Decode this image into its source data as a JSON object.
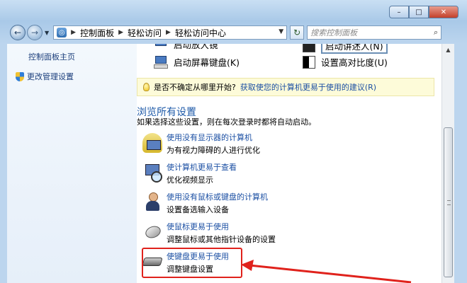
{
  "window": {
    "controls": {
      "minimize": "–",
      "maximize": "□",
      "close": "✕"
    }
  },
  "nav": {
    "back_icon": "←",
    "forward_icon": "→",
    "crumb_icon": "◎",
    "breadcrumbs": [
      "控制面板",
      "轻松访问",
      "轻松访问中心"
    ],
    "refresh_icon": "↻",
    "search_placeholder": "搜索控制面板"
  },
  "sidebar": {
    "home_link": "控制面板主页",
    "admin_link": "更改管理设置"
  },
  "top_items": {
    "left_cut": "启动放大镜",
    "right_cut": "启动讲述人(N)",
    "left": "启动屏幕键盘(K)",
    "right": "设置高对比度(U)"
  },
  "tip": {
    "question": "是否不确定从哪里开始?",
    "link": "获取使您的计算机更易于使用的建议(R)"
  },
  "section": {
    "title": "浏览所有设置",
    "description": "如果选择这些设置，则在每次登录时都将自动启动。"
  },
  "options": [
    {
      "link": "使用没有显示器的计算机",
      "desc": "为有视力障碍的人进行优化",
      "icon": "monitor-icon"
    },
    {
      "link": "使计算机更易于查看",
      "desc": "优化视频显示",
      "icon": "magnifier-icon"
    },
    {
      "link": "使用没有鼠标或键盘的计算机",
      "desc": "设置备选输入设备",
      "icon": "person-icon"
    },
    {
      "link": "使鼠标更易于使用",
      "desc": "调整鼠标或其他指针设备的设置",
      "icon": "mouse-icon"
    },
    {
      "link": "使键盘更易于使用",
      "desc": "调整键盘设置",
      "icon": "keyboard-icon"
    }
  ],
  "colors": {
    "link": "#1b4fa3",
    "highlight": "#e0221c",
    "tip_bg": "#fdfbd9"
  }
}
